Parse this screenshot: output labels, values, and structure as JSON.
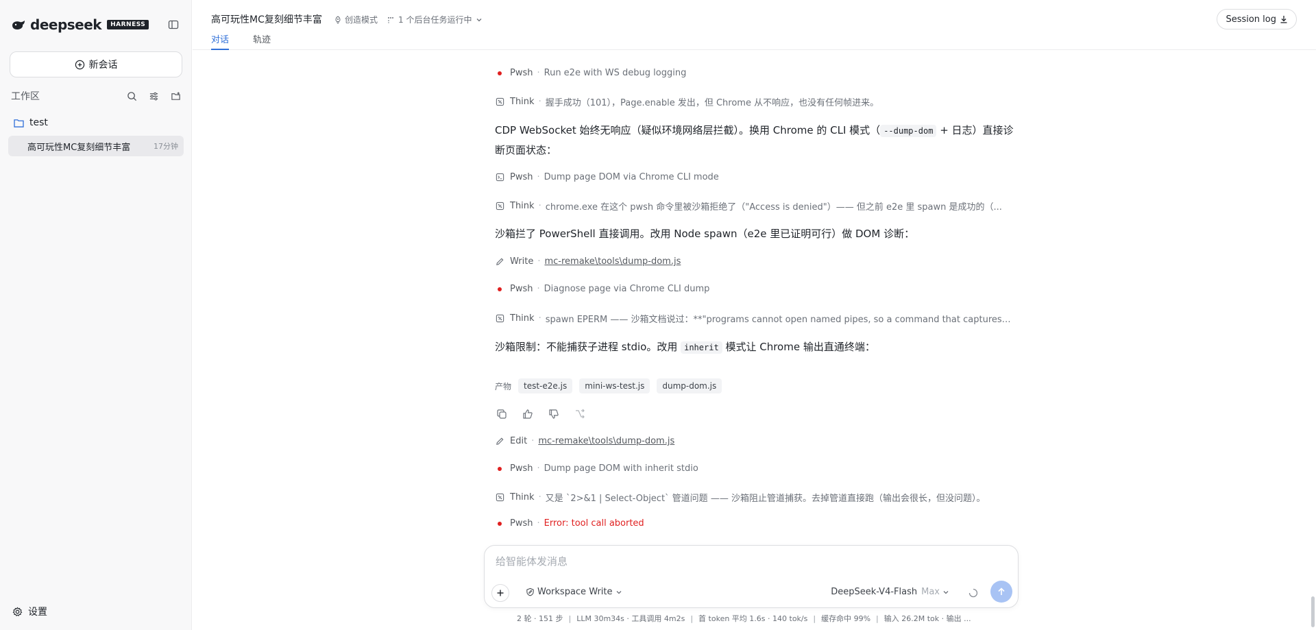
{
  "app": {
    "logo_text": "deepseek",
    "badge": "HARNESS"
  },
  "sidebar": {
    "new_chat_label": "新会话",
    "workspace_label": "工作区",
    "folder_name": "test",
    "session_title": "高可玩性MC复刻细节丰富",
    "session_time": "17分钟",
    "settings_label": "设置"
  },
  "header": {
    "title": "高可玩性MC复刻细节丰富",
    "mode": "创造模式",
    "background_tasks": "1 个后台任务运行中",
    "session_log": "Session log",
    "tabs": [
      {
        "label": "对话"
      },
      {
        "label": "轨迹"
      }
    ]
  },
  "log": {
    "l1": {
      "tool": "Pwsh",
      "desc": "Run e2e with WS debug logging"
    },
    "l2": {
      "tool": "Think",
      "desc": "握手成功（101），Page.enable 发出，但 Chrome 从不响应，也没有任何帧进来。"
    },
    "p1": {
      "a": "CDP WebSocket 始终无响应（疑似环境网络层拦截）。换用 Chrome 的 CLI 模式（",
      "code": "--dump-dom",
      "b": " + 日志）直接诊断页面状态："
    },
    "l3": {
      "tool": "Pwsh",
      "desc": "Dump page DOM via Chrome CLI mode"
    },
    "l4": {
      "tool": "Think",
      "desc": "chrome.exe 在这个 pwsh 命令里被沙箱拒绝了（\"Access is denied\"）—— 但之前 e2e 里 spawn 是成功的（..."
    },
    "p2": {
      "a": "沙箱拦了 PowerShell 直接调用。改用 Node spawn（e2e 里已证明可行）做 DOM 诊断："
    },
    "l5": {
      "tool": "Write",
      "desc": "mc-remake\\tools\\dump-dom.js"
    },
    "l6": {
      "tool": "Pwsh",
      "desc": "Diagnose page via Chrome CLI dump"
    },
    "l7": {
      "tool": "Think",
      "desc": "spawn EPERM —— 沙箱文档说过：**\"programs cannot open named pipes, so a command that captures an..."
    },
    "p3": {
      "a": "沙箱限制：不能捕获子进程 stdio。改用 ",
      "code": "inherit",
      "b": " 模式让 Chrome 输出直通终端："
    },
    "artifacts_label": "产物",
    "artifacts": [
      "test-e2e.js",
      "mini-ws-test.js",
      "dump-dom.js"
    ],
    "l8": {
      "tool": "Edit",
      "desc": "mc-remake\\tools\\dump-dom.js"
    },
    "l9": {
      "tool": "Pwsh",
      "desc": "Dump page DOM with inherit stdio"
    },
    "l10": {
      "tool": "Think",
      "desc": "又是 `2>&1 | Select-Object` 管道问题 —— 沙箱阻止管道捕获。去掉管道直接跑（输出会很长，但没问题）。"
    },
    "l11": {
      "tool": "Pwsh",
      "desc": "Error: tool call aborted"
    },
    "separator": "·"
  },
  "composer": {
    "placeholder": "给智能体发消息",
    "workspace_mode": "Workspace Write",
    "model": "DeepSeek-V4-Flash",
    "effort": "Max"
  },
  "status": {
    "s1": "2 轮 · 151 步",
    "s2": "LLM 30m34s · 工具调用 4m2s",
    "s3": "首 token 平均 1.6s · 140 tok/s",
    "s4": "缓存命中 99%",
    "s5": "输入 26.2M tok · 输出 ...",
    "divider": "|"
  },
  "colors": {
    "accent": "#2f6fd8",
    "error": "#e02020",
    "send": "#a8c3f4"
  },
  "icons": {
    "bullet": "red-dot-icon",
    "think": "brain-icon",
    "terminal": "terminal-icon",
    "write": "pencil-icon"
  }
}
